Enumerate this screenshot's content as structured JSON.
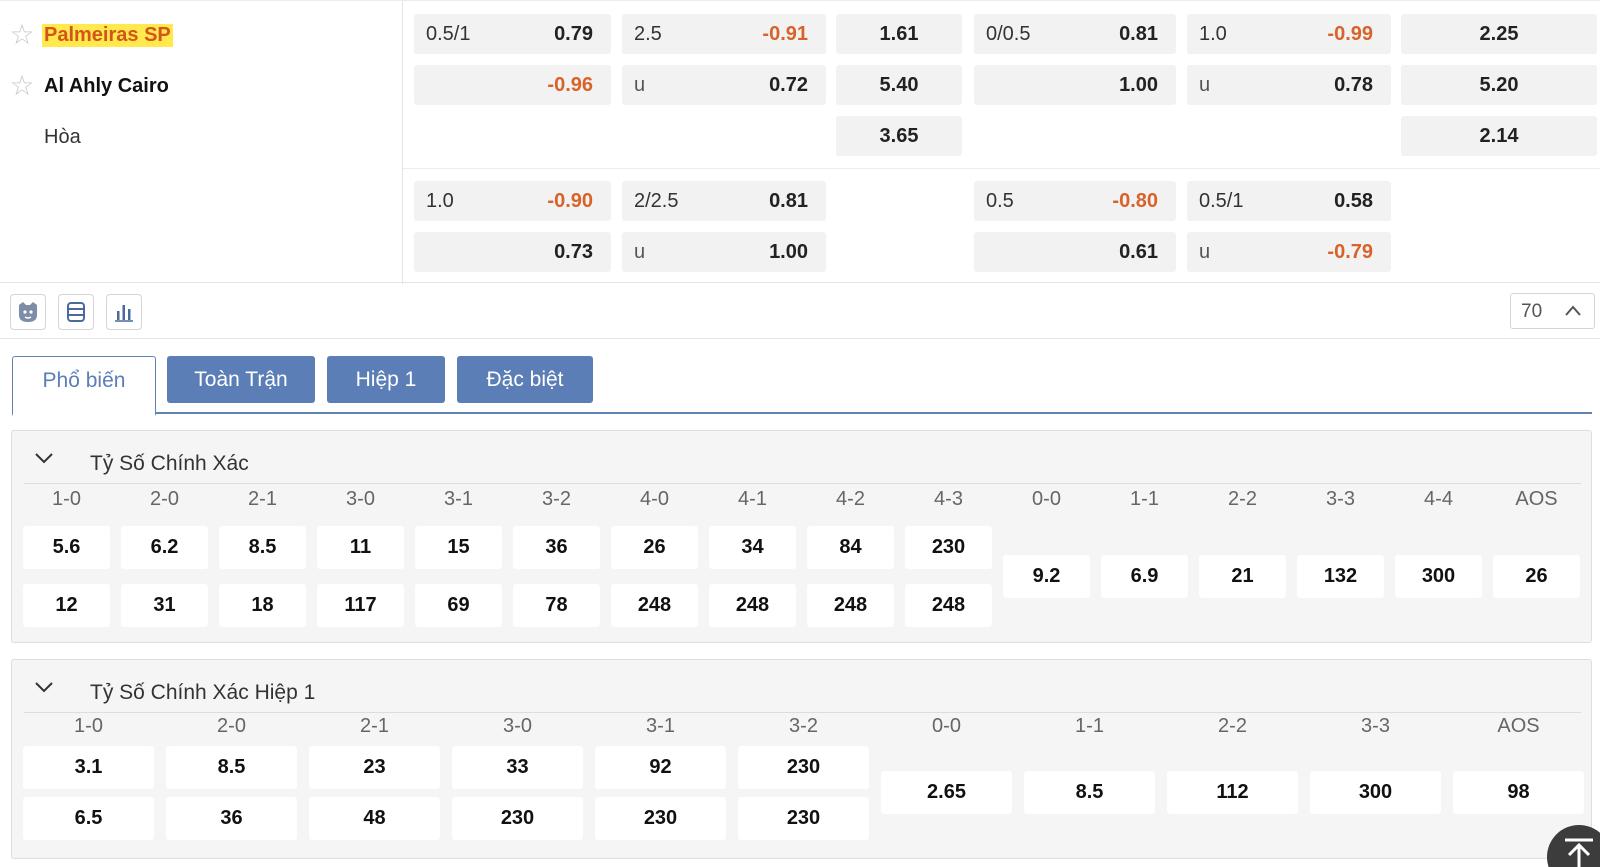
{
  "match": {
    "home": "Palmeiras SP",
    "away": "Al Ahly Cairo",
    "draw": "Hòa"
  },
  "odds_row1": {
    "ah_line": "0.5/1",
    "ah_home": "0.79",
    "ah_away": "-0.96",
    "ou_line": "2.5",
    "ou_over": "-0.91",
    "ou_u": "u",
    "ou_under": "0.72",
    "x12_home": "1.61",
    "x12_away": "5.40",
    "x12_draw": "3.65",
    "h1_ah_line": "0/0.5",
    "h1_ah_home": "0.81",
    "h1_ah_away": "1.00",
    "h1_ou_line": "1.0",
    "h1_ou_over": "-0.99",
    "h1_ou_u": "u",
    "h1_ou_under": "0.78",
    "h1_x12_home": "2.25",
    "h1_x12_away": "5.20",
    "h1_x12_draw": "2.14"
  },
  "odds_row2": {
    "ah_line": "1.0",
    "ah_home": "-0.90",
    "ah_away": "0.73",
    "ou_line": "2/2.5",
    "ou_over": "0.81",
    "ou_u": "u",
    "ou_under": "1.00",
    "h1_ah_line": "0.5",
    "h1_ah_home": "-0.80",
    "h1_ah_away": "0.61",
    "h1_ou_line": "0.5/1",
    "h1_ou_over": "0.58",
    "h1_ou_u": "u",
    "h1_ou_under": "-0.79"
  },
  "toolbar": {
    "icons": [
      "lion-icon",
      "list-icon",
      "bar-chart-icon"
    ],
    "pager_value": "70"
  },
  "tabs": [
    "Phổ biến",
    "Toàn Trận",
    "Hiệp 1",
    "Đặc biệt"
  ],
  "correct_score": {
    "title": "Tỷ Số Chính Xác",
    "win_scores": [
      "1-0",
      "2-0",
      "2-1",
      "3-0",
      "3-1",
      "3-2",
      "4-0",
      "4-1",
      "4-2",
      "4-3"
    ],
    "home_odds": [
      "5.6",
      "6.2",
      "8.5",
      "11",
      "15",
      "36",
      "26",
      "34",
      "84",
      "230"
    ],
    "away_odds": [
      "12",
      "31",
      "18",
      "117",
      "69",
      "78",
      "248",
      "248",
      "248",
      "248"
    ],
    "draw_scores": [
      "0-0",
      "1-1",
      "2-2",
      "3-3",
      "4-4",
      "AOS"
    ],
    "draw_odds": [
      "9.2",
      "6.9",
      "21",
      "132",
      "300",
      "26"
    ]
  },
  "correct_score_h1": {
    "title": "Tỷ Số Chính Xác Hiệp 1",
    "win_scores": [
      "1-0",
      "2-0",
      "2-1",
      "3-0",
      "3-1",
      "3-2"
    ],
    "home_odds": [
      "3.1",
      "8.5",
      "23",
      "33",
      "92",
      "230"
    ],
    "away_odds": [
      "6.5",
      "36",
      "48",
      "230",
      "230",
      "230"
    ],
    "draw_scores": [
      "0-0",
      "1-1",
      "2-2",
      "3-3",
      "AOS"
    ],
    "draw_odds": [
      "2.65",
      "8.5",
      "112",
      "300",
      "98"
    ]
  },
  "colors": {
    "accent": "#5a7eb5",
    "negative": "#d8632a",
    "highlight_bg": "#ffe94d",
    "highlight_text": "#d4541b"
  }
}
